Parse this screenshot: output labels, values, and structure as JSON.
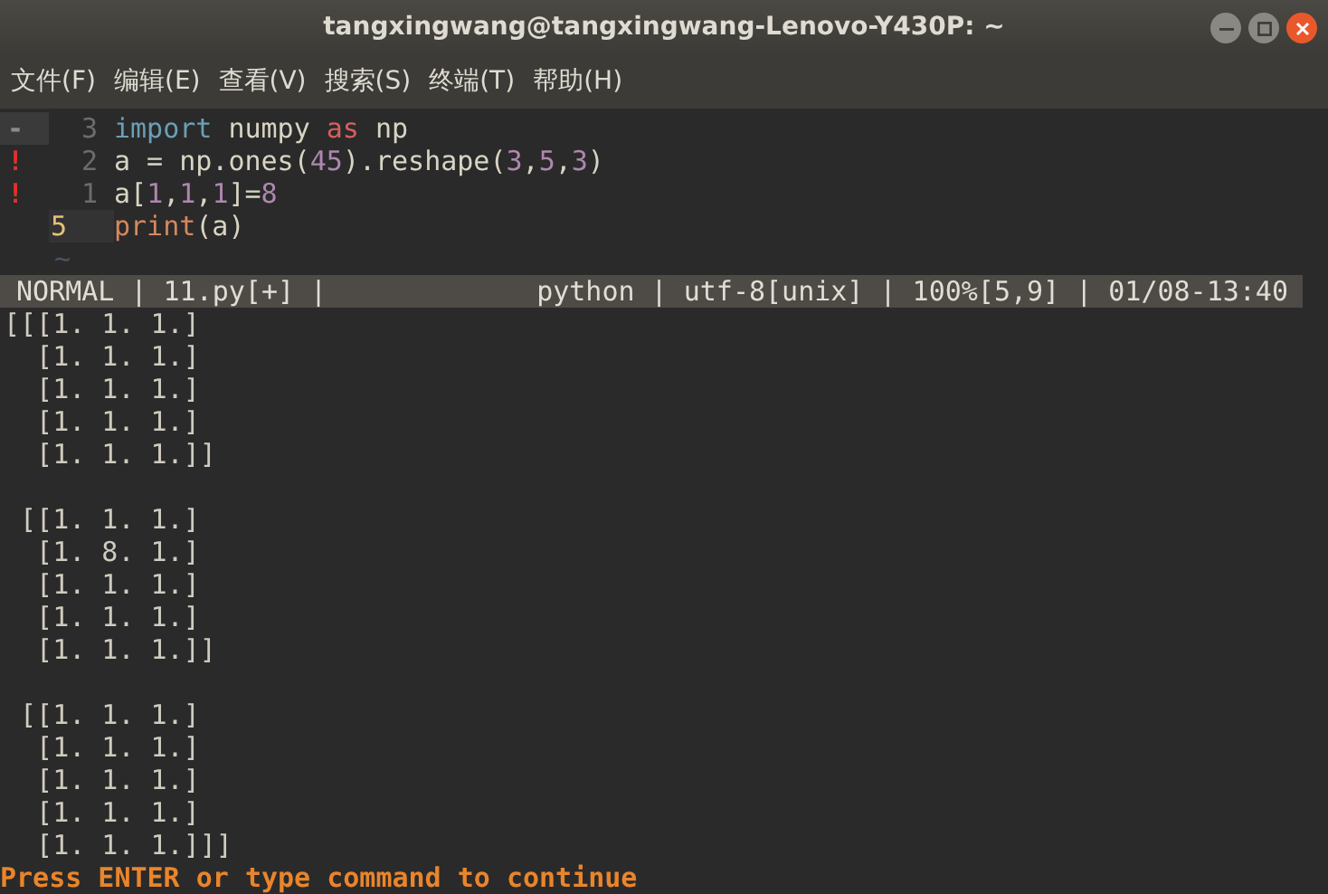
{
  "window": {
    "title": "tangxingwang@tangxingwang-Lenovo-Y430P: ~"
  },
  "menu": [
    "文件(F)",
    "编辑(E)",
    "查看(V)",
    "搜索(S)",
    "终端(T)",
    "帮助(H)"
  ],
  "editor": {
    "lines": [
      {
        "sign": "-",
        "number": "3",
        "current": false,
        "tokens": [
          {
            "kind": "keyword",
            "text": "import"
          },
          {
            "kind": "plain",
            "text": " numpy "
          },
          {
            "kind": "operator",
            "text": "as"
          },
          {
            "kind": "plain",
            "text": " np"
          }
        ]
      },
      {
        "sign": "!",
        "number": "2",
        "current": false,
        "tokens": [
          {
            "kind": "plain",
            "text": "a = np.ones("
          },
          {
            "kind": "number",
            "text": "45"
          },
          {
            "kind": "plain",
            "text": ").reshape("
          },
          {
            "kind": "number",
            "text": "3"
          },
          {
            "kind": "plain",
            "text": ","
          },
          {
            "kind": "number",
            "text": "5"
          },
          {
            "kind": "plain",
            "text": ","
          },
          {
            "kind": "number",
            "text": "3"
          },
          {
            "kind": "plain",
            "text": ")"
          }
        ]
      },
      {
        "sign": "!",
        "number": "1",
        "current": false,
        "tokens": [
          {
            "kind": "plain",
            "text": "a["
          },
          {
            "kind": "number",
            "text": "1"
          },
          {
            "kind": "plain",
            "text": ","
          },
          {
            "kind": "number",
            "text": "1"
          },
          {
            "kind": "plain",
            "text": ","
          },
          {
            "kind": "number",
            "text": "1"
          },
          {
            "kind": "plain",
            "text": "]="
          },
          {
            "kind": "number",
            "text": "8"
          }
        ]
      },
      {
        "number": "5",
        "current": true,
        "tokens": [
          {
            "kind": "builtin",
            "text": "print"
          },
          {
            "kind": "plain",
            "text": "(a)"
          }
        ]
      }
    ],
    "filler": "~"
  },
  "status_line": {
    "left": "NORMAL | 11.py[+] |",
    "right": "python | utf-8[unix] | 100%[5,9] | 01/08-13:40"
  },
  "output": [
    [
      "[[[1. 1. 1.]",
      "  [1. 1. 1.]",
      "  [1. 1. 1.]",
      "  [1. 1. 1.]",
      "  [1. 1. 1.]]"
    ],
    [
      " [[1. 1. 1.]",
      "  [1. 8. 1.]",
      "  [1. 1. 1.]",
      "  [1. 1. 1.]",
      "  [1. 1. 1.]]"
    ],
    [
      " [[1. 1. 1.]",
      "  [1. 1. 1.]",
      "  [1. 1. 1.]",
      "  [1. 1. 1.]",
      "  [1. 1. 1.]]]"
    ]
  ],
  "prompt": "Press ENTER or type command to continue"
}
